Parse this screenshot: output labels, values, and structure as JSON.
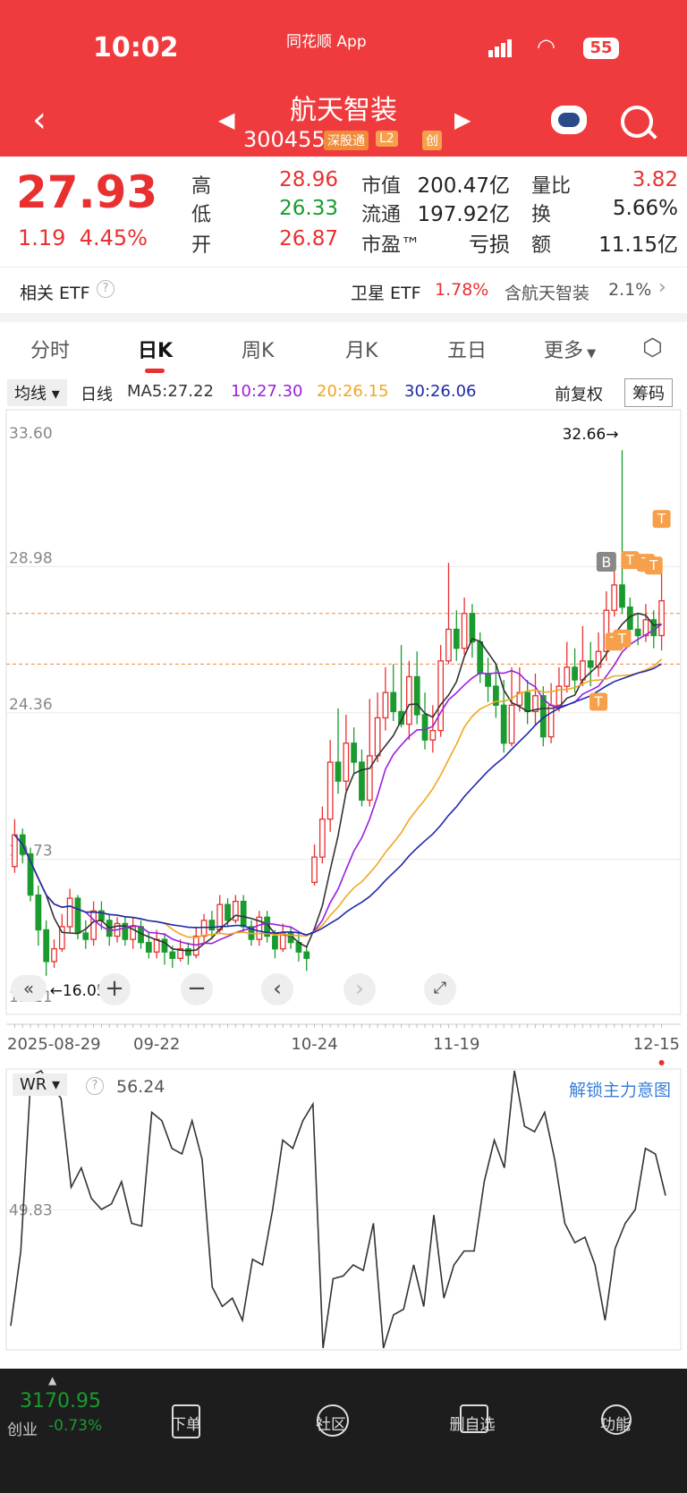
{
  "status": {
    "time": "10:02",
    "carrier": "同花顺 App",
    "battery": "55"
  },
  "header": {
    "name": "航天智装",
    "code": "300455",
    "tags": [
      "深股通",
      "L2",
      "创"
    ]
  },
  "quote": {
    "price": "27.93",
    "change": "1.19",
    "change_pct": "4.45%",
    "labels": {
      "high": "高",
      "low": "低",
      "open": "开",
      "mktcap": "市值",
      "float": "流通",
      "pe": "市盈™",
      "vol_ratio": "量比",
      "turnover": "换",
      "amount": "额"
    },
    "high": "28.96",
    "low": "26.33",
    "open": "26.87",
    "mktcap": "200.47亿",
    "float": "197.92亿",
    "pe": "亏损",
    "vol_ratio": "3.82",
    "turnover": "5.66%",
    "amount": "11.15亿"
  },
  "etf": {
    "label": "相关 ETF",
    "item1_name": "卫星 ETF",
    "item1_pct": "1.78%",
    "item2_name": "含航天智装",
    "item2_pct": "2.1%"
  },
  "tabs": [
    "分时",
    "日K",
    "周K",
    "月K",
    "五日",
    "更多"
  ],
  "legend": {
    "selector": "均线",
    "period": "日线",
    "ma5": "MA5:27.22",
    "ma10": "10:27.30",
    "ma20": "20:26.15",
    "ma30": "30:26.06",
    "adjust": "前复权",
    "chips": "筹码"
  },
  "colors": {
    "up": "#e93030",
    "down": "#1a9b2f",
    "ma5": "#333333",
    "ma10": "#9b1fe0",
    "ma20": "#f0a81c",
    "ma30": "#1e2aa8"
  },
  "chart_data": [
    {
      "type": "candlestick",
      "y_ticks": [
        "33.60",
        "28.98",
        "24.36",
        "19.73",
        "15.11"
      ],
      "ylim": [
        15.11,
        33.6
      ],
      "x_tick_labels": [
        "2025-08-29",
        "09-22",
        "10-24",
        "11-19",
        "12-15"
      ],
      "max_label": "32.66→",
      "min_label": "←16.05",
      "reference_lines": [
        27.5,
        25.9
      ],
      "markers": [
        "B",
        "T"
      ],
      "candles": [
        [
          19.5,
          20.5,
          21.0,
          19.3
        ],
        [
          20.5,
          19.9,
          20.7,
          19.6
        ],
        [
          19.9,
          18.6,
          20.1,
          18.4
        ],
        [
          18.6,
          17.5,
          18.9,
          17.0
        ],
        [
          17.5,
          16.5,
          17.8,
          16.05
        ],
        [
          16.5,
          16.9,
          17.2,
          16.3
        ],
        [
          16.9,
          17.6,
          18.0,
          16.8
        ],
        [
          17.6,
          18.5,
          18.8,
          17.4
        ],
        [
          18.5,
          17.4,
          18.6,
          17.2
        ],
        [
          17.4,
          17.2,
          17.8,
          16.9
        ],
        [
          17.2,
          18.1,
          18.4,
          17.0
        ],
        [
          18.1,
          17.8,
          18.4,
          17.5
        ],
        [
          17.8,
          17.3,
          18.0,
          17.0
        ],
        [
          17.3,
          17.7,
          17.9,
          17.1
        ],
        [
          17.7,
          17.2,
          17.9,
          17.0
        ],
        [
          17.2,
          17.6,
          17.9,
          16.9
        ],
        [
          17.6,
          17.1,
          17.8,
          16.9
        ],
        [
          17.1,
          16.8,
          17.4,
          16.6
        ],
        [
          16.8,
          17.2,
          17.5,
          16.6
        ],
        [
          17.2,
          16.8,
          17.4,
          16.4
        ],
        [
          16.8,
          16.6,
          17.0,
          16.3
        ],
        [
          16.6,
          16.9,
          17.2,
          16.5
        ],
        [
          16.9,
          16.7,
          17.1,
          16.4
        ],
        [
          16.7,
          17.3,
          17.6,
          16.6
        ],
        [
          17.3,
          17.8,
          18.0,
          17.1
        ],
        [
          17.8,
          17.5,
          18.1,
          17.2
        ],
        [
          17.5,
          18.3,
          18.6,
          17.4
        ],
        [
          18.3,
          17.8,
          18.5,
          17.6
        ],
        [
          17.8,
          18.4,
          18.6,
          17.7
        ],
        [
          18.4,
          17.6,
          18.6,
          17.4
        ],
        [
          17.6,
          17.2,
          17.8,
          17.0
        ],
        [
          17.2,
          17.9,
          18.1,
          17.0
        ],
        [
          17.9,
          17.3,
          18.1,
          17.1
        ],
        [
          17.3,
          16.9,
          17.5,
          16.6
        ],
        [
          16.9,
          17.4,
          17.7,
          16.8
        ],
        [
          17.4,
          17.1,
          17.6,
          16.9
        ],
        [
          17.1,
          16.8,
          17.4,
          16.5
        ],
        [
          16.8,
          16.6,
          17.0,
          16.2
        ],
        [
          19.0,
          19.8,
          20.2,
          18.9
        ],
        [
          19.8,
          21.0,
          21.4,
          19.6
        ],
        [
          21.0,
          22.8,
          23.5,
          20.6
        ],
        [
          22.8,
          22.2,
          24.5,
          21.8
        ],
        [
          22.2,
          23.4,
          24.3,
          21.9
        ],
        [
          23.4,
          22.8,
          23.9,
          22.4
        ],
        [
          22.8,
          21.6,
          23.2,
          21.4
        ],
        [
          21.6,
          23.0,
          24.8,
          21.4
        ],
        [
          23.0,
          24.2,
          25.0,
          22.8
        ],
        [
          24.2,
          25.0,
          25.8,
          23.8
        ],
        [
          25.0,
          24.4,
          25.9,
          24.1
        ],
        [
          24.4,
          24.0,
          26.5,
          23.9
        ],
        [
          24.0,
          25.5,
          26.0,
          23.5
        ],
        [
          25.5,
          24.3,
          26.3,
          24.0
        ],
        [
          24.3,
          23.5,
          25.0,
          23.2
        ],
        [
          23.5,
          23.8,
          24.6,
          23.1
        ],
        [
          23.8,
          26.0,
          26.5,
          23.6
        ],
        [
          26.0,
          27.0,
          29.1,
          25.9
        ],
        [
          27.0,
          26.4,
          27.6,
          26.0
        ],
        [
          26.4,
          27.5,
          28.0,
          26.2
        ],
        [
          27.5,
          26.6,
          27.8,
          26.1
        ],
        [
          26.6,
          25.6,
          26.9,
          25.3
        ],
        [
          25.6,
          25.2,
          26.1,
          24.7
        ],
        [
          25.2,
          24.6,
          25.9,
          24.2
        ],
        [
          24.6,
          23.4,
          25.4,
          23.1
        ],
        [
          23.4,
          24.6,
          25.8,
          23.3
        ],
        [
          24.6,
          25.0,
          25.8,
          24.4
        ],
        [
          25.0,
          24.4,
          25.4,
          24.0
        ],
        [
          24.4,
          24.9,
          25.6,
          24.0
        ],
        [
          24.9,
          23.6,
          25.2,
          23.3
        ],
        [
          23.6,
          24.6,
          25.3,
          23.4
        ],
        [
          24.6,
          25.2,
          25.8,
          24.4
        ],
        [
          25.2,
          25.8,
          26.6,
          25.0
        ],
        [
          25.8,
          25.4,
          26.4,
          25.0
        ],
        [
          25.4,
          26.0,
          27.1,
          25.2
        ],
        [
          26.0,
          25.8,
          26.6,
          25.2
        ],
        [
          25.8,
          26.3,
          26.9,
          25.5
        ],
        [
          26.3,
          27.6,
          28.2,
          26.0
        ],
        [
          27.6,
          28.4,
          28.9,
          27.4
        ],
        [
          28.4,
          27.7,
          32.66,
          27.5
        ],
        [
          27.7,
          27.0,
          28.0,
          26.6
        ],
        [
          27.0,
          26.8,
          27.5,
          26.5
        ],
        [
          26.8,
          27.3,
          27.8,
          26.6
        ],
        [
          27.3,
          26.8,
          27.6,
          26.4
        ],
        [
          26.8,
          27.9,
          28.96,
          26.33
        ]
      ]
    },
    {
      "type": "line",
      "name": "WR",
      "value_label": "56.24",
      "y_ticks": [
        "49.83"
      ],
      "ylim": [
        0,
        100
      ],
      "values": [
        8,
        35,
        98,
        100,
        95,
        90,
        58,
        65,
        54,
        50,
        52,
        60,
        45,
        44,
        85,
        82,
        72,
        70,
        82,
        68,
        22,
        15,
        18,
        10,
        32,
        30,
        50,
        75,
        72,
        82,
        88,
        0,
        25,
        26,
        30,
        28,
        45,
        0,
        12,
        14,
        30,
        15,
        48,
        18,
        30,
        35,
        35,
        60,
        75,
        65,
        100,
        80,
        78,
        85,
        68,
        45,
        38,
        40,
        30,
        10,
        36,
        45,
        50,
        72,
        70,
        55
      ]
    }
  ],
  "wr_header": {
    "label": "WR",
    "value": "56.24",
    "unlock": "解锁主力意图"
  },
  "bottom": {
    "index_value": "3170.95",
    "index_name": "创业",
    "index_pct": "-0.73%",
    "nav": [
      "下单",
      "社区",
      "删自选",
      "功能"
    ]
  }
}
